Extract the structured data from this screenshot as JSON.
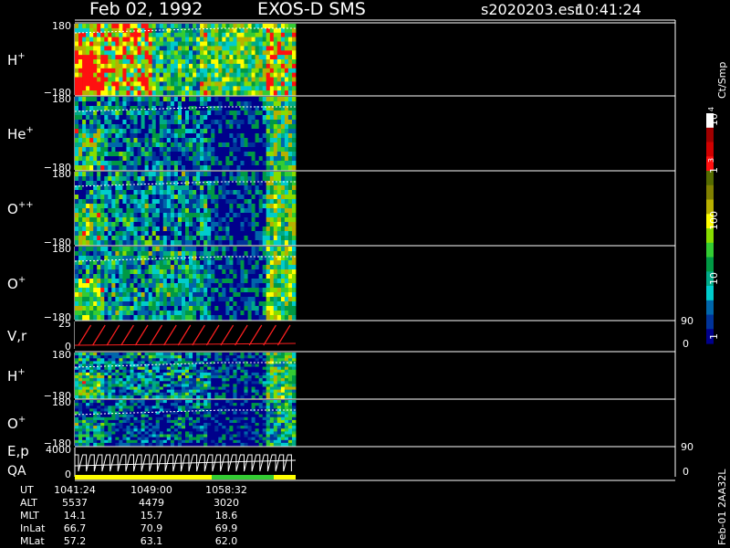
{
  "header": {
    "date": "Feb 02, 1992",
    "instrument": "EXOS-D SMS",
    "file": "s2020203.esr",
    "time": "10:41:24"
  },
  "side_label": "Feb-01 2AA32L",
  "colorbar": {
    "unit_label": "Ct/Smp",
    "tick_labels": [
      "10",
      "1",
      "100",
      "10",
      "1"
    ],
    "exponents": [
      "4",
      "3"
    ],
    "colors": [
      "#ffffff",
      "#a00000",
      "#d00000",
      "#ff1010",
      "#556b00",
      "#808000",
      "#b8b000",
      "#ffff00",
      "#88dd00",
      "#33cc33",
      "#009944",
      "#00aa88",
      "#00cccc",
      "#0066aa",
      "#003399",
      "#00008b"
    ]
  },
  "panels": [
    {
      "name": "H",
      "sup": "+",
      "ymax": "180",
      "ymin": "−180"
    },
    {
      "name": "He",
      "sup": "+",
      "ymax": "180",
      "ymin": "−180"
    },
    {
      "name": "O",
      "sup": "++",
      "ymax": "180",
      "ymin": "−180"
    },
    {
      "name": "O",
      "sup": "+",
      "ymax": "180",
      "ymin": "−180"
    },
    {
      "name": "V,r",
      "sup": "",
      "ymax": "25",
      "ymin": "0",
      "right_max": "90",
      "right_min": "0"
    },
    {
      "name": "H",
      "sup": "+",
      "ymax": "180",
      "ymin": "−180"
    },
    {
      "name": "O",
      "sup": "+",
      "ymax": "180",
      "ymin": "−180"
    },
    {
      "name": "E,p",
      "name2": "QA",
      "sup": "",
      "ymax": "4000",
      "ymin": "0",
      "right_max": "90",
      "right_min": "0"
    }
  ],
  "ephemeris": {
    "labels": [
      "UT",
      "ALT",
      "MLT",
      "InLat",
      "MLat"
    ],
    "columns": [
      [
        "1041:24",
        "5537",
        "14.1",
        "66.7",
        "57.2"
      ],
      [
        "1049:00",
        "4479",
        "15.7",
        "70.9",
        "63.1"
      ],
      [
        "1058:32",
        "3020",
        "18.6",
        "69.9",
        "62.0"
      ]
    ]
  },
  "chart_data": {
    "type": "heatmap",
    "title": "Feb 02, 1992   EXOS-D SMS",
    "time_ticks": [
      "1041:24",
      "1049:00",
      "1058:32"
    ],
    "angle_range": [
      -180,
      180
    ],
    "count_scale": {
      "min": 1,
      "max": 10000,
      "scale": "log"
    },
    "vr_range": [
      0,
      25
    ],
    "ep_range": [
      0,
      4000
    ],
    "right_axis_range": [
      0,
      90
    ],
    "qa_colors": [
      "#ffff00",
      "#33cc33",
      "#ffff00"
    ]
  }
}
